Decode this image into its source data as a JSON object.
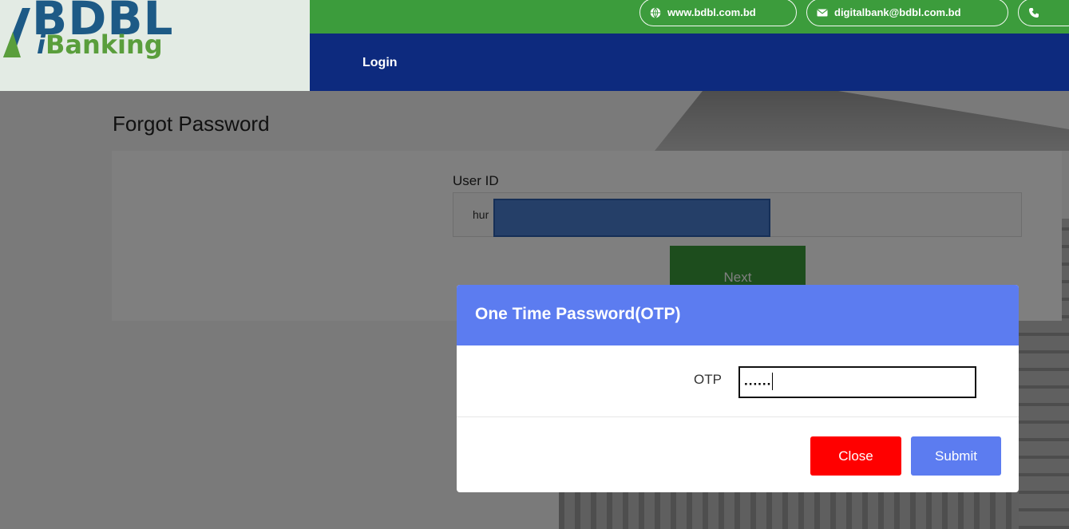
{
  "brand": {
    "name": "BDBL",
    "product_prefix": "i",
    "product_rest": "Banking"
  },
  "topbar": {
    "website": "www.bdbl.com.bd",
    "email": "digitalbank@bdbl.com.bd",
    "phone_partial": ""
  },
  "nav": {
    "login": "Login"
  },
  "page": {
    "title": "Forgot Password",
    "user_id_label": "User ID",
    "user_id_value_visible": "hur",
    "next_button": "Next"
  },
  "modal": {
    "title": "One Time Password(OTP)",
    "otp_label": "OTP",
    "otp_value_masked": "......",
    "close_button": "Close",
    "submit_button": "Submit"
  },
  "colors": {
    "topbar_green": "#3c9c3c",
    "navbar_blue": "#0d2a7e",
    "modal_header": "#5c7cf0",
    "close_red": "#ff0000",
    "next_green": "#3a9a3a"
  },
  "icons": {
    "website": "globe-icon",
    "email": "envelope-icon",
    "phone": "phone-icon"
  }
}
